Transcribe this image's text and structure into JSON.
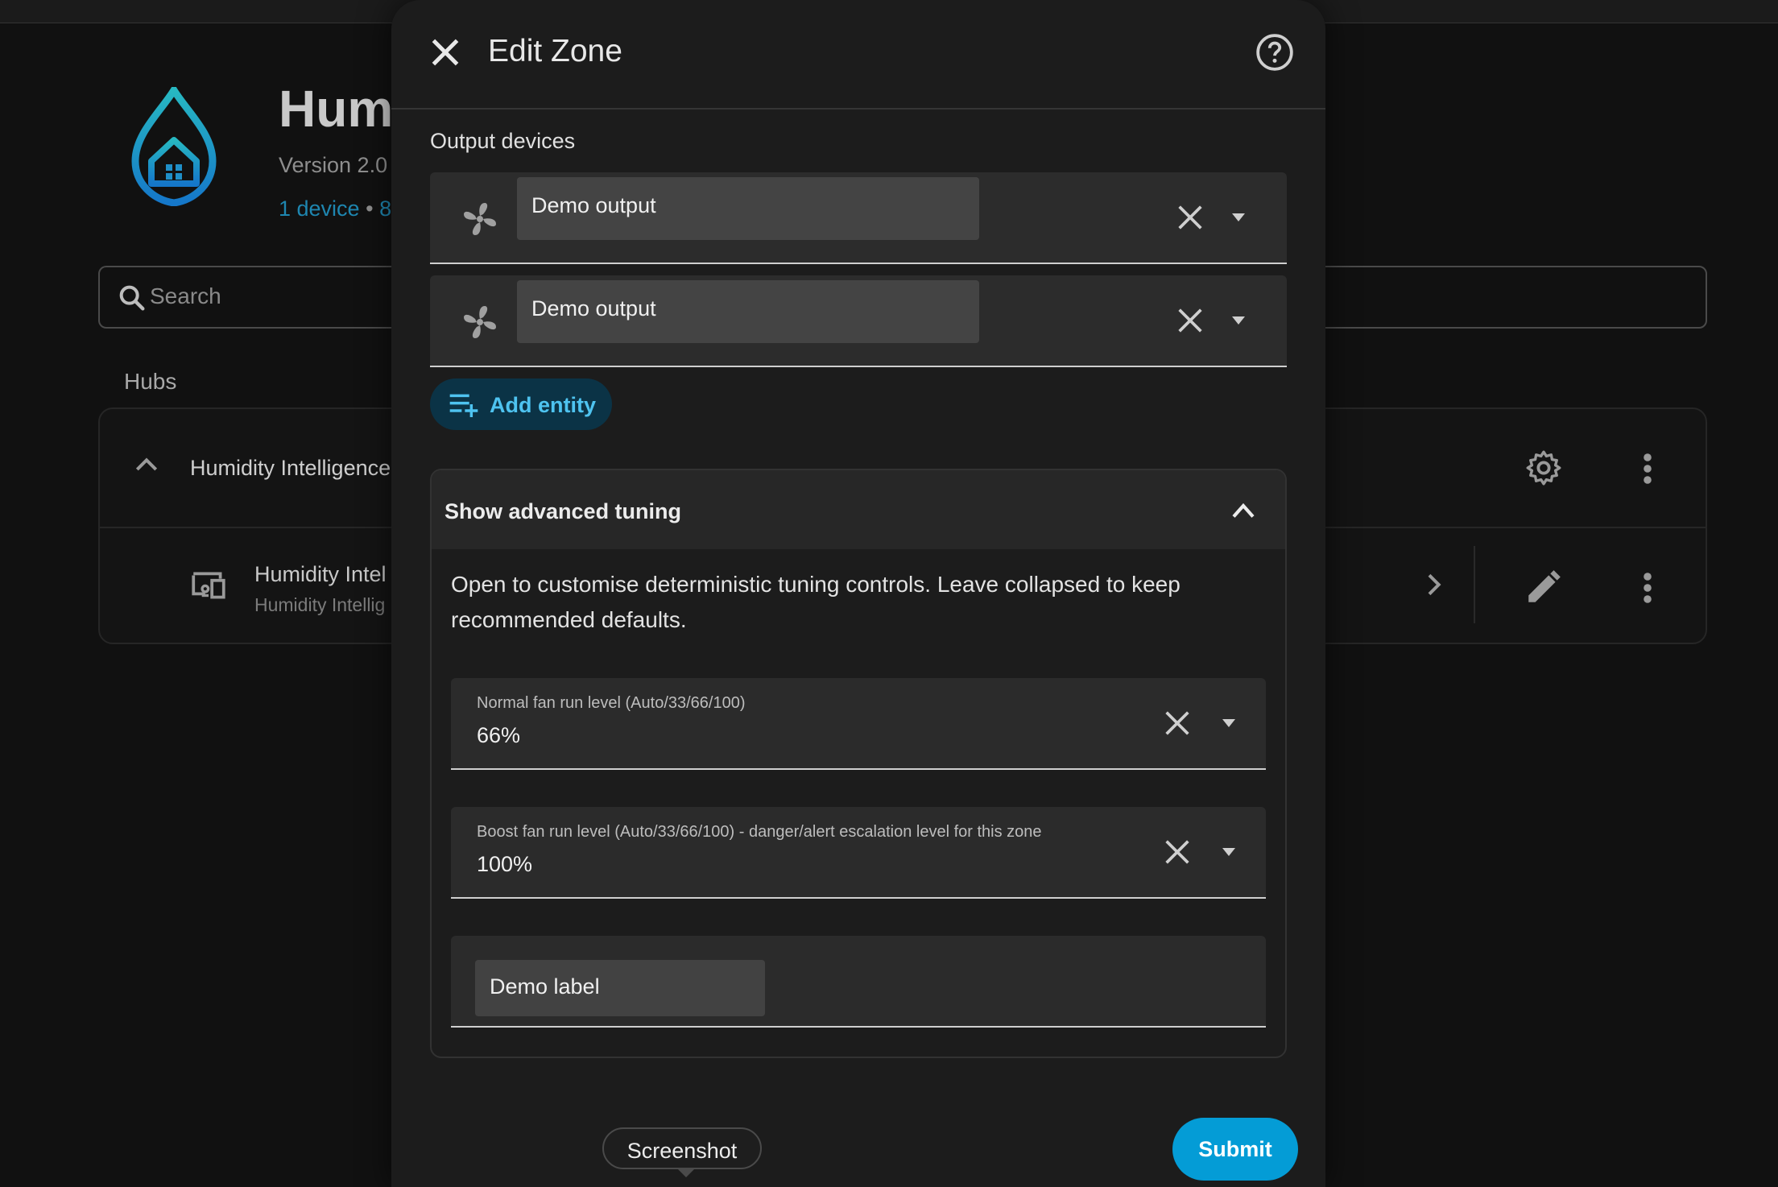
{
  "app": {
    "title": "Hum",
    "version": "Version 2.0",
    "devices_link": "1 device",
    "separator": "•",
    "entities_link_fragment": "8"
  },
  "search": {
    "placeholder": "Search"
  },
  "hubs": {
    "section_label": "Hubs",
    "hub": {
      "name": "Humidity Intelligence",
      "device": {
        "name": "Humidity Intel",
        "subtitle": "Humidity Intellig"
      }
    }
  },
  "dialog": {
    "title": "Edit Zone",
    "output_devices": {
      "label": "Output devices",
      "items": [
        {
          "name": "Demo output",
          "icon": "fan-icon"
        },
        {
          "name": "Demo output",
          "icon": "fan-icon"
        }
      ]
    },
    "add_entity_label": "Add entity",
    "advanced": {
      "title": "Show advanced tuning",
      "description": "Open to customise deterministic tuning controls. Leave collapsed to keep recommended defaults.",
      "fields": [
        {
          "label": "Normal fan run level (Auto/33/66/100)",
          "value": "66%"
        },
        {
          "label": "Boost fan run level (Auto/33/66/100) - danger/alert escalation level for this zone",
          "value": "100%"
        }
      ],
      "label_field": {
        "chip": "Demo label"
      }
    },
    "tooltip": "Screenshot",
    "submit_label": "Submit"
  },
  "colors": {
    "accent": "#049cd6",
    "link": "#1e86b0",
    "add_entity_text": "#4ec3f0",
    "dialog_bg": "#1c1c1c"
  }
}
